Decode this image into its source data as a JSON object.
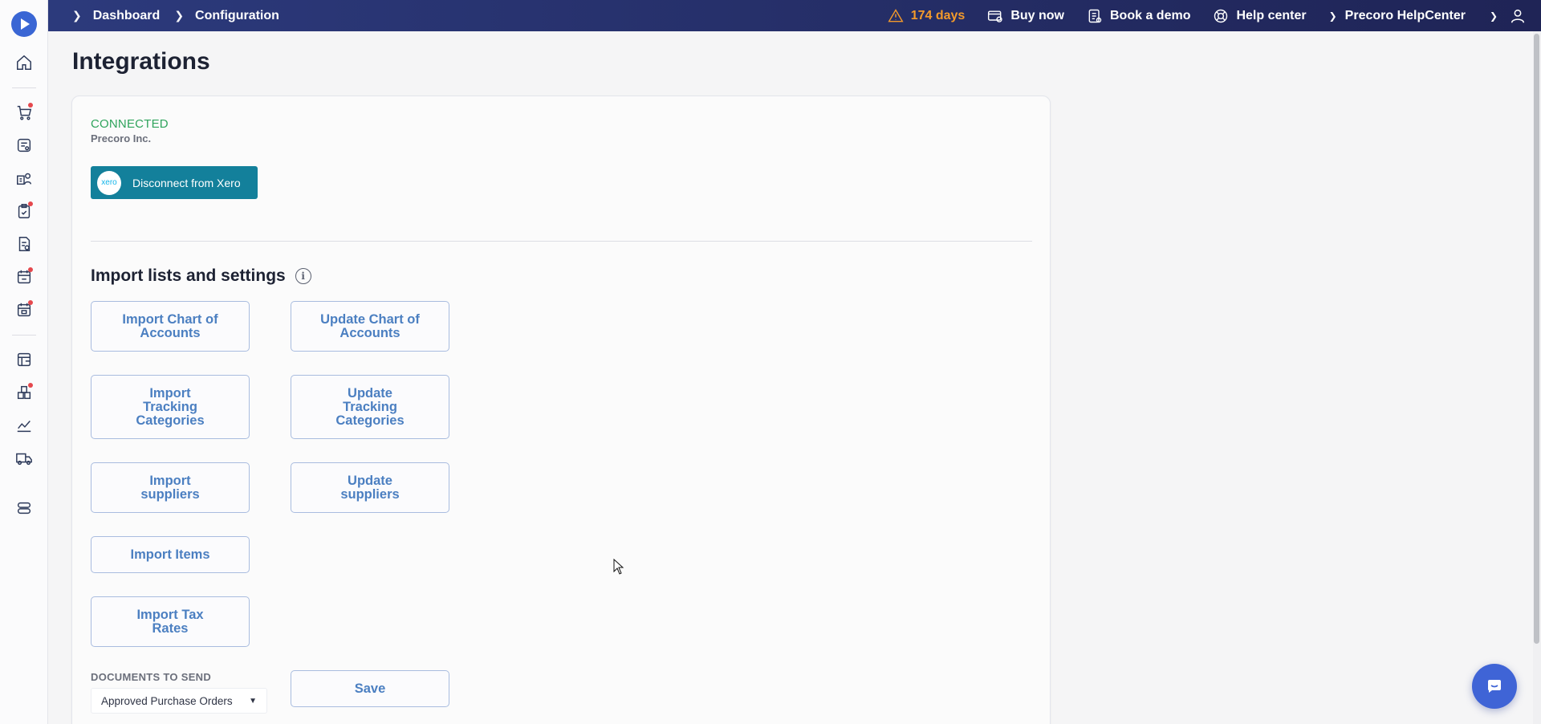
{
  "breadcrumb": [
    "Dashboard",
    "Configuration"
  ],
  "topbar": {
    "trial": "174 days",
    "buy_now": "Buy now",
    "book_demo": "Book a demo",
    "help_center": "Help center",
    "account": "Precoro HelpCenter"
  },
  "page": {
    "title": "Integrations"
  },
  "integration": {
    "status": "CONNECTED",
    "company": "Precoro Inc.",
    "xero_logo_text": "xero",
    "disconnect_label": "Disconnect from Xero"
  },
  "import_section": {
    "title": "Import lists and settings",
    "buttons": {
      "import_chart": "Import Chart of Accounts",
      "update_chart": "Update Chart of Accounts",
      "import_tracking": "Import Tracking Categories",
      "update_tracking": "Update Tracking Categories",
      "import_suppliers": "Import suppliers",
      "update_suppliers": "Update suppliers",
      "import_items": "Import Items",
      "import_tax": "Import Tax Rates",
      "save": "Save"
    }
  },
  "documents": {
    "label": "DOCUMENTS TO SEND",
    "selected": "Approved Purchase Orders"
  },
  "colors": {
    "topbar": "#2c3a7c",
    "connected": "#2fa45c",
    "xero_button": "#13809b",
    "button_text": "#4b7fc1",
    "warning": "#f39a2b",
    "chat": "#3f64d6"
  }
}
